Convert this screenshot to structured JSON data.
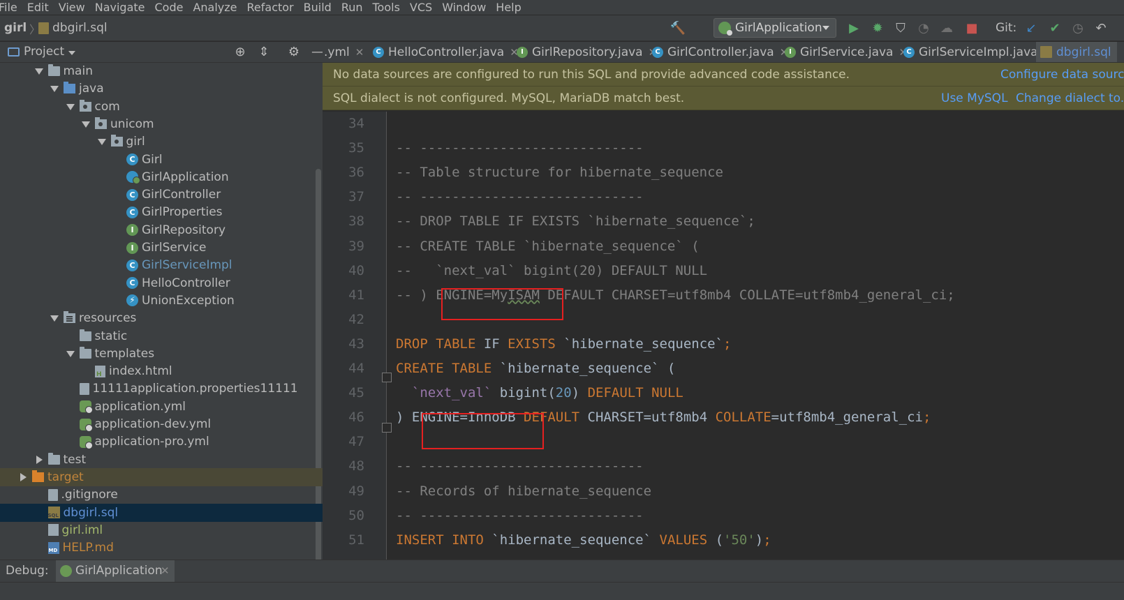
{
  "menu": [
    "File",
    "Edit",
    "View",
    "Navigate",
    "Code",
    "Analyze",
    "Refactor",
    "Build",
    "Run",
    "Tools",
    "VCS",
    "Window",
    "Help"
  ],
  "nav": {
    "project": "girl",
    "file": "dbgirl.sql",
    "run_config": "GirlApplication",
    "git_label": "Git:"
  },
  "project_panel": {
    "title": "Project"
  },
  "tree": [
    {
      "label": "main",
      "icon": "folder",
      "indent": 2,
      "arrow": "open"
    },
    {
      "label": "java",
      "icon": "folder-src",
      "indent": 3,
      "arrow": "open"
    },
    {
      "label": "com",
      "icon": "folder-pkg",
      "indent": 4,
      "arrow": "open"
    },
    {
      "label": "unicom",
      "icon": "folder-pkg",
      "indent": 5,
      "arrow": "open"
    },
    {
      "label": "girl",
      "icon": "folder-pkg",
      "indent": 6,
      "arrow": "open"
    },
    {
      "label": "Girl",
      "icon": "class",
      "indent": 7,
      "arrow": "none"
    },
    {
      "label": "GirlApplication",
      "icon": "spring",
      "indent": 7,
      "arrow": "none"
    },
    {
      "label": "GirlController",
      "icon": "class",
      "indent": 7,
      "arrow": "none"
    },
    {
      "label": "GirlProperties",
      "icon": "class",
      "indent": 7,
      "arrow": "none"
    },
    {
      "label": "GirlRepository",
      "icon": "iface",
      "indent": 7,
      "arrow": "none"
    },
    {
      "label": "GirlService",
      "icon": "iface",
      "indent": 7,
      "arrow": "none"
    },
    {
      "label": "GirlServiceImpl",
      "icon": "class",
      "indent": 7,
      "arrow": "none",
      "style": "blue"
    },
    {
      "label": "HelloController",
      "icon": "class",
      "indent": 7,
      "arrow": "none"
    },
    {
      "label": "UnionException",
      "icon": "exception",
      "indent": 7,
      "arrow": "none"
    },
    {
      "label": "resources",
      "icon": "folder-res",
      "indent": 3,
      "arrow": "open"
    },
    {
      "label": "static",
      "icon": "folder",
      "indent": 4,
      "arrow": "none"
    },
    {
      "label": "templates",
      "icon": "folder",
      "indent": 4,
      "arrow": "open"
    },
    {
      "label": "index.html",
      "icon": "html-file",
      "indent": 5,
      "arrow": "none"
    },
    {
      "label": "11111application.properties11111",
      "icon": "file",
      "indent": 4,
      "arrow": "none"
    },
    {
      "label": "application.yml",
      "icon": "yml",
      "indent": 4,
      "arrow": "none"
    },
    {
      "label": "application-dev.yml",
      "icon": "yml",
      "indent": 4,
      "arrow": "none"
    },
    {
      "label": "application-pro.yml",
      "icon": "yml",
      "indent": 4,
      "arrow": "none"
    },
    {
      "label": "test",
      "icon": "folder",
      "indent": 2,
      "arrow": "closed"
    },
    {
      "label": "target",
      "icon": "folder-target",
      "indent": 1,
      "arrow": "closed",
      "style": "orange",
      "row": "target"
    },
    {
      "label": ".gitignore",
      "icon": "file",
      "indent": 2,
      "arrow": "none"
    },
    {
      "label": "dbgirl.sql",
      "icon": "sql",
      "indent": 2,
      "arrow": "none",
      "row": "selected",
      "style": "link"
    },
    {
      "label": "girl.iml",
      "icon": "iml",
      "indent": 2,
      "arrow": "none",
      "style": "green"
    },
    {
      "label": "HELP.md",
      "icon": "md",
      "indent": 2,
      "arrow": "none",
      "style": "orange"
    }
  ],
  "tabs": [
    {
      "label": ".yml",
      "icon": "none"
    },
    {
      "label": "HelloController.java",
      "icon": "c"
    },
    {
      "label": "GirlRepository.java",
      "icon": "i"
    },
    {
      "label": "GirlController.java",
      "icon": "c"
    },
    {
      "label": "GirlService.java",
      "icon": "i"
    },
    {
      "label": "GirlServiceImpl.java",
      "icon": "c"
    },
    {
      "label": "dbgirl.sql",
      "icon": "sql",
      "active": true
    }
  ],
  "notifications": {
    "datasource_text": "No data sources are configured to run this SQL and provide advanced code assistance.",
    "datasource_link": "Configure data source",
    "dialect_text": "SQL dialect is not configured. MySQL, MariaDB match best.",
    "use_mysql": "Use MySQL",
    "change_dialect": "Change dialect to..."
  },
  "editor": {
    "line_numbers": [
      "34",
      "35",
      "36",
      "37",
      "38",
      "39",
      "40",
      "41",
      "42",
      "43",
      "44",
      "45",
      "46",
      "47",
      "48",
      "49",
      "50",
      "51"
    ],
    "lines": [
      [],
      [
        [
          "cmt",
          "-- ----------------------------"
        ]
      ],
      [
        [
          "cmt",
          "-- Table structure for hibernate_sequence"
        ]
      ],
      [
        [
          "cmt",
          "-- ----------------------------"
        ]
      ],
      [
        [
          "cmt",
          "-- DROP TABLE IF EXISTS `hibernate_sequence`;"
        ]
      ],
      [
        [
          "cmt",
          "-- CREATE TABLE `hibernate_sequence` ("
        ]
      ],
      [
        [
          "cmt",
          "--   `next_val` bigint(20) DEFAULT NULL"
        ]
      ],
      [
        [
          "cmt",
          "-- ) "
        ],
        [
          "cmt",
          "ENGINE=My"
        ],
        [
          "cmt uline",
          "ISAM"
        ],
        [
          "cmt",
          " DEFAULT CHARSET=utf8mb4 COLLATE=utf8mb4_general_ci;"
        ]
      ],
      [],
      [
        [
          "kw",
          "DROP TABLE "
        ],
        [
          "id",
          "IF "
        ],
        [
          "kw",
          "EXISTS "
        ],
        [
          "id",
          "`hibernate_sequence`"
        ],
        [
          "kw",
          ";"
        ]
      ],
      [
        [
          "kw",
          "CREATE TABLE "
        ],
        [
          "id",
          "`hibernate_sequence` ("
        ]
      ],
      [
        [
          "id",
          "  "
        ],
        [
          "col",
          "`next_val`"
        ],
        [
          "id",
          " bigint("
        ],
        [
          "num",
          "20"
        ],
        [
          "id",
          ") "
        ],
        [
          "kw",
          "DEFAULT NULL"
        ]
      ],
      [
        [
          "id",
          ") ENGINE=InnoDB "
        ],
        [
          "kw",
          "DEFAULT "
        ],
        [
          "id",
          "CHARSET=utf8mb4 "
        ],
        [
          "kw",
          "COLLATE"
        ],
        [
          "id",
          "=utf8mb4_general_ci"
        ],
        [
          "kw",
          ";"
        ]
      ],
      [],
      [
        [
          "cmt",
          "-- ----------------------------"
        ]
      ],
      [
        [
          "cmt",
          "-- Records of hibernate_sequence"
        ]
      ],
      [
        [
          "cmt",
          "-- ----------------------------"
        ]
      ],
      [
        [
          "kw",
          "INSERT INTO "
        ],
        [
          "id",
          "`hibernate_sequence` "
        ],
        [
          "kw",
          "VALUES "
        ],
        [
          "id",
          "("
        ],
        [
          "str",
          "'50'"
        ],
        [
          "id",
          ")"
        ],
        [
          "kw",
          ";"
        ]
      ]
    ]
  },
  "debug": {
    "label": "Debug:",
    "tab": "GirlApplication"
  },
  "colors": {
    "highlight_box": "#e52020",
    "notification_bg": "#5b5a34",
    "link": "#589df6"
  }
}
